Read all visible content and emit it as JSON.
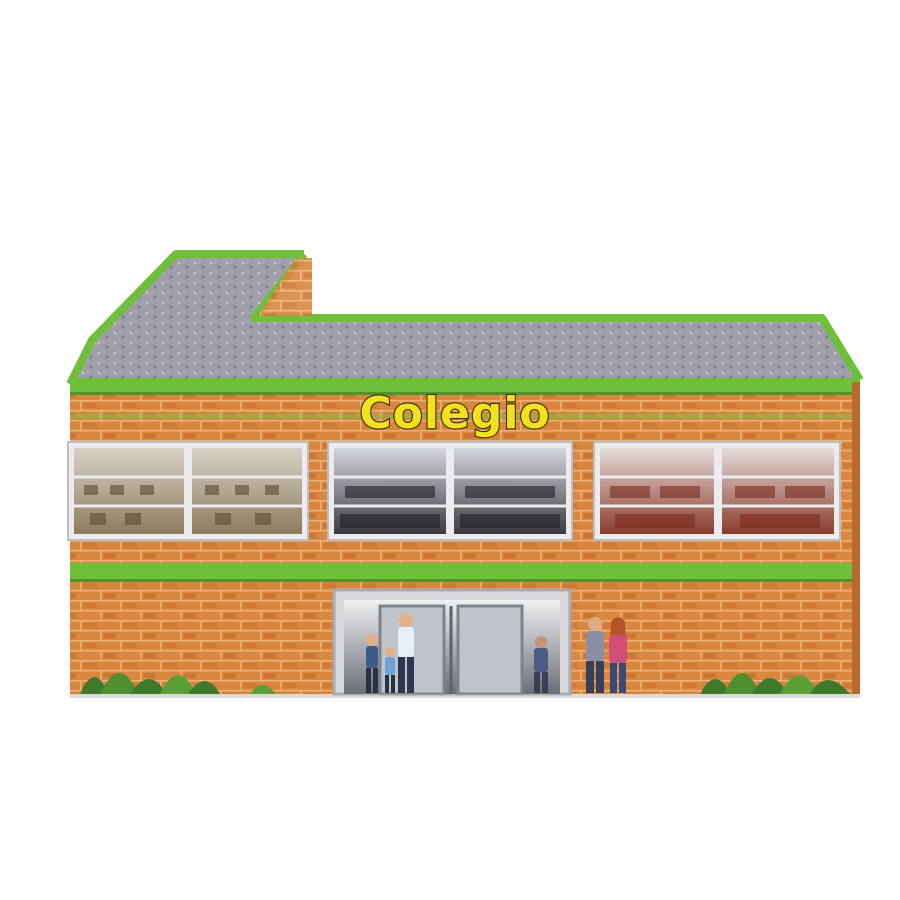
{
  "sign": {
    "text": "Colegio"
  },
  "colors": {
    "roof": "#9a98a6",
    "roof_trim": "#6fbf3a",
    "brick": "#d9863e",
    "mortar": "#e9b27a",
    "band": "#6fbf3a",
    "window_frame": "#e8e8ec",
    "plants": "#3f7a2a"
  },
  "icons": [
    "building",
    "window",
    "door",
    "person",
    "plant"
  ]
}
